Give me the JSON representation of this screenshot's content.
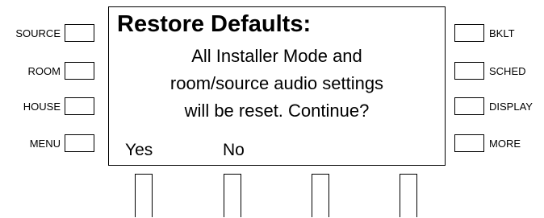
{
  "left_buttons": [
    {
      "label": "SOURCE"
    },
    {
      "label": "ROOM"
    },
    {
      "label": "HOUSE"
    },
    {
      "label": "MENU"
    }
  ],
  "right_buttons": [
    {
      "label": "BKLT"
    },
    {
      "label": "SCHED"
    },
    {
      "label": "DISPLAY"
    },
    {
      "label": "MORE"
    }
  ],
  "screen": {
    "title": "Restore Defaults:",
    "message_lines": [
      "All Installer Mode and",
      "room/source audio settings",
      "will be reset. Continue?"
    ],
    "softkeys": [
      "Yes",
      "No"
    ]
  }
}
